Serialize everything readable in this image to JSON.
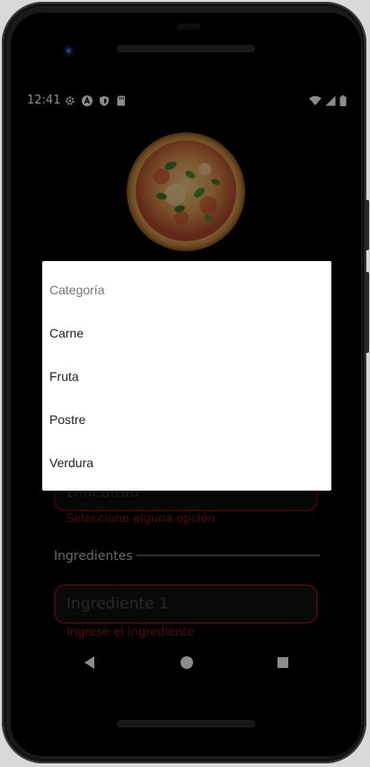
{
  "status_bar": {
    "time": "12:41",
    "left_icons": [
      "gear-icon",
      "app-a-icon",
      "shield-icon",
      "sd-card-icon"
    ],
    "right_icons": [
      "wifi-icon",
      "signal-icon",
      "battery-icon"
    ]
  },
  "form": {
    "difficulty_placeholder": "Dificultad",
    "difficulty_error": "Seleccione alguna opción",
    "ingredients_section_label": "Ingredientes",
    "ingredient_placeholder": "Ingrediente 1",
    "ingredient_error": "Ingrese el ingrediente"
  },
  "dialog": {
    "title": "Categoría",
    "options": [
      "Carne",
      "Fruta",
      "Postre",
      "Verdura"
    ]
  },
  "nav_bar": {
    "buttons": [
      "back-icon",
      "home-icon",
      "recents-icon"
    ]
  },
  "colors": {
    "background": "#000000",
    "error": "#a10f0f",
    "field_border": "#7a0d0d",
    "dialog_bg": "#ffffff"
  }
}
